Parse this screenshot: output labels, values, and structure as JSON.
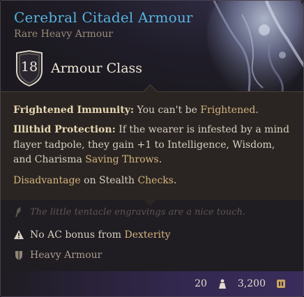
{
  "item": {
    "name": "Cerebral Citadel Armour",
    "subtitle": "Rare Heavy Armour",
    "armour_class_value": "18",
    "armour_class_label": "Armour Class"
  },
  "properties": {
    "p1_keyword": "Frightened Immunity:",
    "p1_text_a": " You can't be ",
    "p1_link": "Frightened",
    "p1_text_b": ".",
    "p2_keyword": "Illithid Protection:",
    "p2_text_a": " If the wearer is infested by a mind flayer tadpole, they gain +1 to Intelligence, Wisdom, and Charisma ",
    "p2_link": "Saving Throws",
    "p2_text_b": ".",
    "p3_link_a": "Disadvantage",
    "p3_text_a": " on Stealth ",
    "p3_link_b": "Checks",
    "p3_text_b": "."
  },
  "flavour_text": "The little tentacle engravings are a nice touch.",
  "notes": {
    "ac_note_a": "No AC bonus from ",
    "ac_note_link": "Dexterity",
    "armour_type": "Heavy Armour"
  },
  "footer": {
    "weight": "20",
    "value": "3,200"
  },
  "icons": {
    "flavour": "feather-icon",
    "warning": "warning-triangle-icon",
    "armour": "armour-shield-icon",
    "weight": "weight-icon",
    "gold": "gold-coin-icon"
  },
  "colors": {
    "item_name": "#56b4e0",
    "keyword": "#d6b57e",
    "body_text": "#d9d0c2"
  }
}
